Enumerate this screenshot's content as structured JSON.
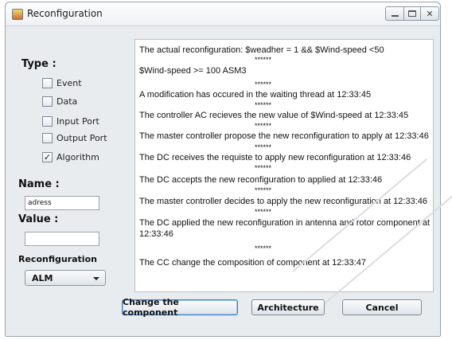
{
  "window": {
    "title": "Reconfiguration"
  },
  "left_panel": {
    "type_label": "Type :",
    "checkboxes": [
      {
        "label": "Event",
        "checked": false
      },
      {
        "label": "Data",
        "checked": false
      },
      {
        "label": "Input Port",
        "checked": false
      },
      {
        "label": "Output Port",
        "checked": false
      },
      {
        "label": "Algorithm",
        "checked": true
      }
    ],
    "name_label": "Name :",
    "name_value": "adress",
    "value_label": "Value :",
    "value_value": "",
    "reconfiguration_label": "Reconfiguration",
    "reconfiguration_selected": "ALM"
  },
  "log": {
    "entries": [
      "The actual reconfiguration:  $weadher = 1 && $Wind-speed <50",
      "$Wind-speed >= 100  ASM3",
      "A modification has occured in the waiting thread  at 12:33:45",
      "The controller AC recieves the new value of $Wind-speed at 12:33:45",
      "The master controller propose the new reconfiguration to apply at 12:33:46",
      "The DC receives the requiste to apply new reconfiguration at 12:33:46",
      "The DC accepts the new reconfiguration to applied at 12:33:46",
      "The master controller decides to apply the new reconfiguration at 12:33:46",
      "The DC applied the new reconfiguration in antenna and rotor component at",
      "12:33:46",
      "The CC change the composition of component at 12:33:47"
    ],
    "separator": "******"
  },
  "buttons": {
    "change": "Change the component",
    "architecture": "Architecture",
    "cancel": "Cancel"
  }
}
